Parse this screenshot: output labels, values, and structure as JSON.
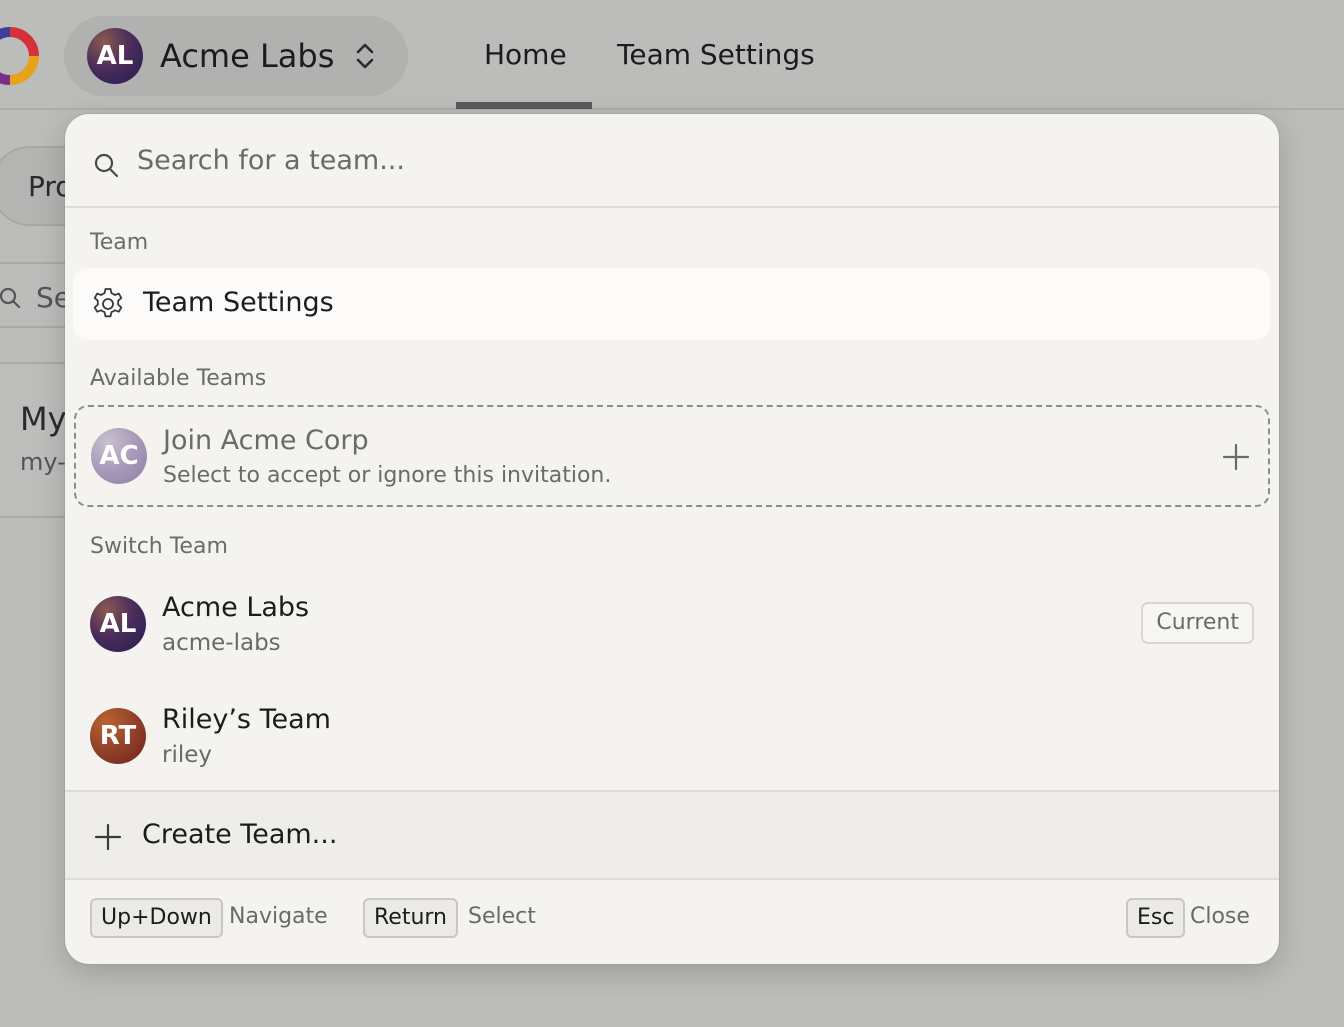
{
  "header": {
    "current_team_initials": "AL",
    "current_team_name": "Acme Labs",
    "tabs": [
      {
        "label": "Home",
        "active": true
      },
      {
        "label": "Team Settings",
        "active": false
      }
    ]
  },
  "background": {
    "pill_label": "Projects",
    "search_text": "Se",
    "card_title": "My",
    "card_sub": "my-"
  },
  "popover": {
    "search": {
      "placeholder": "Search for a team...",
      "value": ""
    },
    "sections": {
      "team": "Team",
      "available": "Available Teams",
      "switch": "Switch Team"
    },
    "team_settings_label": "Team Settings",
    "invite": {
      "initials": "AC",
      "title": "Join Acme Corp",
      "subtitle": "Select to accept or ignore this invitation."
    },
    "teams": [
      {
        "initials": "AL",
        "name": "Acme Labs",
        "slug": "acme-labs",
        "badge": "Current"
      },
      {
        "initials": "RT",
        "name": "Riley’s Team",
        "slug": "riley",
        "badge": ""
      }
    ],
    "create_label": "Create Team...",
    "footer": {
      "updown_key": "Up+Down",
      "updown_hint": "Navigate",
      "return_key": "Return",
      "return_hint": "Select",
      "esc_key": "Esc",
      "esc_hint": "Close"
    }
  },
  "colors": {
    "page_background": "#bcbcba",
    "popover_background": "#f4f3f0",
    "highlight_row": "#fcfbf9"
  },
  "icons": [
    "app-logo",
    "chevron-updown-icon",
    "search-icon",
    "gear-icon",
    "plus-icon"
  ]
}
